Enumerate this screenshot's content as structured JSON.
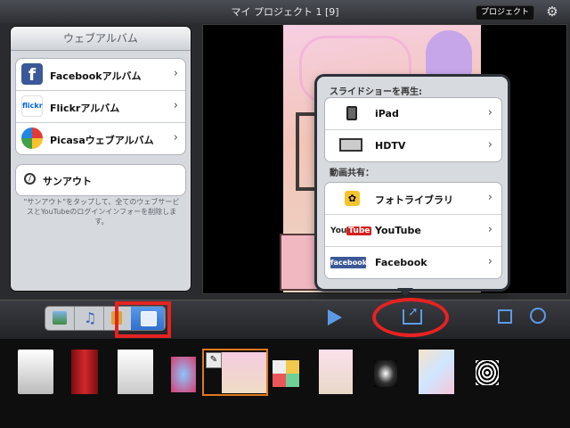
{
  "title": "マイ プロジェクト 1 [9]",
  "project_button": "プロジェクト",
  "web_album": {
    "header": "ウェブアルバム",
    "services": [
      {
        "label": "Facebookアルバム",
        "icon": "facebook-icon"
      },
      {
        "label": "Flickrアルバム",
        "icon": "flickr-icon"
      },
      {
        "label": "Picasaウェブアルバム",
        "icon": "picasa-icon"
      }
    ],
    "signout_label": "サンアウト",
    "note": "\"サンアウト\"をタップして、全てのウェブサービスとYouTubeのログインインフォーを削除します。"
  },
  "share_menu": {
    "slideshow_header": "スライドショーを再生:",
    "slideshow": [
      {
        "label": "iPad",
        "icon": "ipad-icon"
      },
      {
        "label": "HDTV",
        "icon": "tv-icon"
      }
    ],
    "video_share_header": "動画共有：",
    "video_share": [
      {
        "label": "フォトライブラリ",
        "icon": "photos-icon"
      },
      {
        "label": "YouTube",
        "icon": "youtube-icon"
      },
      {
        "label": "Facebook",
        "icon": "facebook-icon"
      }
    ]
  },
  "icons": {
    "flickr_text": "flickr",
    "facebook_text": "facebook",
    "youtube_text": "You",
    "youtube_tube": "Tube"
  },
  "colors": {
    "accent_blue": "#5b9be6",
    "annotation_red": "#e62222",
    "selection_orange": "#e07a1c"
  },
  "filmstrip": {
    "clips": 9,
    "selected_index": 4
  }
}
